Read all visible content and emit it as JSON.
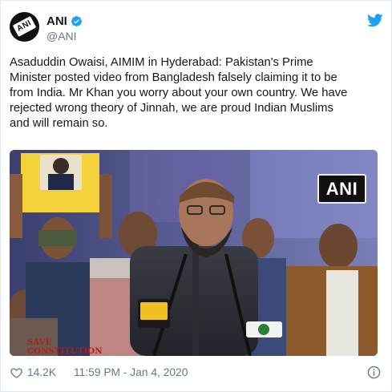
{
  "account": {
    "display_name": "ANI",
    "handle": "@ANI",
    "avatar_text": "ANI",
    "verified": true
  },
  "tweet": {
    "text": "Asaduddin Owaisi, AIMIM in Hyderabad: Pakistan's Prime\nMinister posted video from Bangladesh falsely claiming it to be\nfrom India. Mr Khan you worry about your own country. We have\nrejected wrong theory of Jinnah, we are proud Indian Muslims\nand will remain so."
  },
  "media": {
    "watermark": "ANI",
    "sign_text": "SAVE CONSTITUTION",
    "mic_badge": "4"
  },
  "footer": {
    "likes": "14.2K",
    "timestamp": "11:59 PM - Jan 4, 2020"
  },
  "colors": {
    "twitter_blue": "#1da1f2",
    "text": "#14171a",
    "muted": "#657786",
    "border": "#e1e8ed"
  },
  "icons": [
    "verified-badge-icon",
    "twitter-bird-icon",
    "heart-icon",
    "info-icon"
  ]
}
